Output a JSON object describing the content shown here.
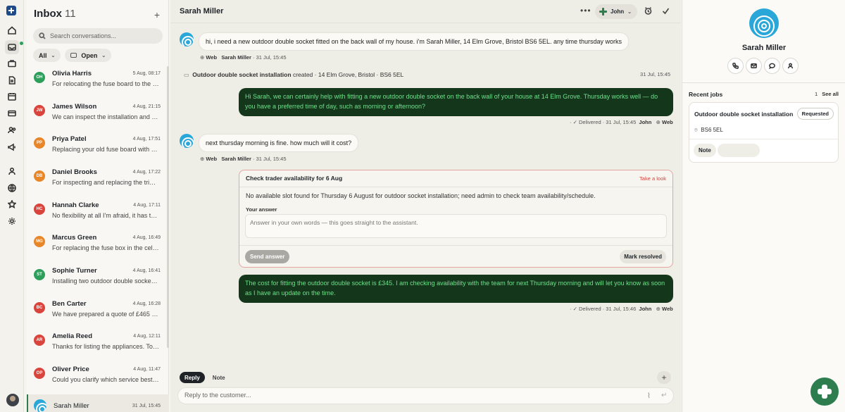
{
  "inbox": {
    "title": "Inbox",
    "count": "11",
    "add_icon": "plus-icon",
    "search_placeholder": "Search conversations...",
    "filter_all": "All",
    "filter_open": "Open",
    "conversations": [
      {
        "initials": "OH",
        "name": "Olivia Harris",
        "time": "5 Aug, 08:17",
        "preview": "For relocating the fuse board to the utility room",
        "color": "#2e9e5b"
      },
      {
        "initials": "JW",
        "name": "James Wilson",
        "time": "4 Aug, 21:15",
        "preview": "We can inspect the installation and recommend",
        "color": "#d9453c"
      },
      {
        "initials": "PP",
        "name": "Priya Patel",
        "time": "4 Aug, 17:51",
        "preview": "Replacing your old fuse board with a new one",
        "color": "#e8862a"
      },
      {
        "initials": "DB",
        "name": "Daniel Brooks",
        "time": "4 Aug, 17:22",
        "preview": "For inspecting and replacing the tripping breaker",
        "color": "#e8862a"
      },
      {
        "initials": "HC",
        "name": "Hannah Clarke",
        "time": "4 Aug, 17:11",
        "preview": "No flexibility at all I'm afraid, it has to be",
        "color": "#d9453c"
      },
      {
        "initials": "MG",
        "name": "Marcus Green",
        "time": "4 Aug, 16:49",
        "preview": "For replacing the fuse box in the cellar",
        "color": "#e8862a"
      },
      {
        "initials": "ST",
        "name": "Sophie Turner",
        "time": "4 Aug, 16:41",
        "preview": "Installing two outdoor double sockets at the",
        "color": "#2e9e5b"
      },
      {
        "initials": "BC",
        "name": "Ben Carter",
        "time": "4 Aug, 16:28",
        "preview": "We have prepared a quote of £465 to replace",
        "color": "#d9453c"
      },
      {
        "initials": "AR",
        "name": "Amelia Reed",
        "time": "4 Aug, 12:11",
        "preview": "Thanks for listing the appliances. To help us",
        "color": "#d9453c"
      },
      {
        "initials": "OP",
        "name": "Oliver Price",
        "time": "4 Aug, 11:47",
        "preview": "Could you clarify which service best fits",
        "color": "#d9453c"
      },
      {
        "initials": "",
        "name": "Sarah Miller",
        "time": "31 Jul, 15:45",
        "preview": "",
        "color": "#29a7d8"
      }
    ]
  },
  "thread": {
    "title": "Sarah Miller",
    "more_icon": "more-icon",
    "assignee": "John",
    "snooze_icon": "alarm-icon",
    "resolve_icon": "check-icon",
    "msg1": {
      "text": "hi, i need a new outdoor double socket fitted on the back wall of my house. i'm Sarah Miller, 14 Elm Grove, Bristol BS6 5EL. any time thursday works",
      "channel": "Web",
      "author": "Sarah Miller",
      "time": "· 31 Jul, 15:45"
    },
    "system": {
      "job": "Outdoor double socket installation",
      "action": "created",
      "detail": "· 14 Elm Grove, Bristol · BS6 5EL",
      "time": "31 Jul, 15:45"
    },
    "msg2": {
      "text": "Hi Sarah, we can certainly help with fitting a new outdoor double socket on the back wall of your house at 14 Elm Grove. Thursday works well — do you have a preferred time of day, such as morning or afternoon?",
      "status": "· ✓ Delivered · 31 Jul, 15:45",
      "author": "John",
      "channel": "Web"
    },
    "msg3": {
      "text": "next thursday morning is fine. how much will it cost?",
      "channel": "Web",
      "author": "Sarah Miller",
      "time": "· 31 Jul, 15:45"
    },
    "task": {
      "title": "Check trader availability for 6 Aug",
      "link": "Take a look",
      "description": "No available slot found for Thursday 6 August for outdoor socket installation; need admin to check team availability/schedule.",
      "answer_label": "Your answer",
      "answer_placeholder": "Answer in your own words — this goes straight to the assistant.",
      "send_label": "Send answer",
      "resolve_label": "Mark resolved"
    },
    "msg4": {
      "text": "The cost for fitting the outdoor double socket is £345. I am checking availability with the team for next Thursday morning and will let you know as soon as I have an update on the time.",
      "status": "· ✓ Delivered · 31 Jul, 15:46",
      "author": "John",
      "channel": "Web"
    },
    "tab_reply": "Reply",
    "tab_note": "Note",
    "composer_placeholder": "Reply to the customer..."
  },
  "panel": {
    "name": "Sarah Miller",
    "recent_jobs_label": "Recent jobs",
    "recent_jobs_count": "1",
    "see_all": "See all",
    "job": {
      "title": "Outdoor double socket installation",
      "status": "Requested",
      "postcode": "BS6 5EL",
      "note_label": "Note"
    }
  }
}
